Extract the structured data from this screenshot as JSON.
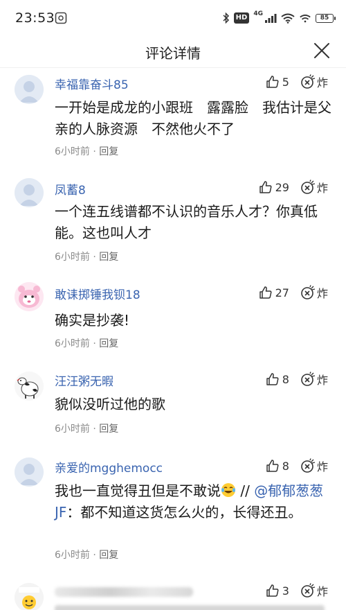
{
  "status": {
    "time": "23:53",
    "hd": "HD",
    "signal_label": "4G",
    "battery": "85"
  },
  "nav": {
    "title": "评论详情"
  },
  "comments": [
    {
      "username": "幸福靠奋斗85",
      "likes": "5",
      "boom": "炸",
      "text": "一开始是成龙的小跟班　露露脸　我估计是父亲的人脉资源　不然他火不了",
      "time": "6小时前",
      "sep": "·",
      "reply": "回复"
    },
    {
      "username": "凤蓄8",
      "likes": "29",
      "boom": "炸",
      "text": "一个连五线谱都不认识的音乐人才？你真低能。这也叫人才",
      "time": "6小时前",
      "sep": "·",
      "reply": "回复"
    },
    {
      "username": "敢诔掷锤我钡18",
      "likes": "27",
      "boom": "炸",
      "text": "确实是抄袭!",
      "time": "6小时前",
      "sep": "·",
      "reply": "回复"
    },
    {
      "username": "汪汪粥无暇",
      "likes": "8",
      "boom": "炸",
      "text": "貌似没听过他的歌",
      "time": "6小时前",
      "sep": "·",
      "reply": "回复"
    },
    {
      "username": "亲爱的mgghemocc",
      "likes": "8",
      "boom": "炸",
      "text_before": "我也一直觉得丑但是不敢说",
      "text_slash": " // ",
      "mention": "@郁郁葱葱JF",
      "text_after": "：都不知道这货怎么火的，长得还丑。",
      "time": "6小时前",
      "sep": "·",
      "reply": "回复"
    },
    {
      "username": "",
      "likes": "3",
      "boom": "炸"
    }
  ]
}
